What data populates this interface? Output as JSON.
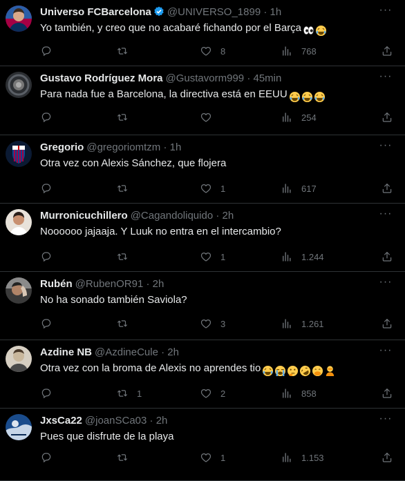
{
  "tweets": [
    {
      "name": "Universo FCBarcelona",
      "verified": true,
      "handle": "@UNIVERSO_1899",
      "time": "1h",
      "text": "Yo también, y creo que no acabaré fichando por el Barça",
      "emojis": [
        "eyes",
        "joy"
      ],
      "replies": "",
      "retweets": "",
      "likes": "8",
      "views": "768",
      "avatar_colors": [
        "#2b5ea7",
        "#a50044"
      ]
    },
    {
      "name": "Gustavo Rodríguez Mora",
      "verified": false,
      "handle": "@Gustavorm999",
      "time": "45min",
      "text": "Para nada fue a Barcelona, la directiva está en EEUU",
      "emojis": [
        "joy",
        "joy",
        "joy"
      ],
      "replies": "",
      "retweets": "",
      "likes": "",
      "views": "254",
      "avatar_colors": [
        "#5a5f66",
        "#2c2f33"
      ]
    },
    {
      "name": "Gregorio",
      "verified": false,
      "handle": "@gregoriomtzm",
      "time": "1h",
      "text": "Otra vez con Alexis Sánchez, que flojera",
      "emojis": [],
      "replies": "",
      "retweets": "",
      "likes": "1",
      "views": "617",
      "avatar_colors": [
        "#004d98",
        "#a50044"
      ]
    },
    {
      "name": "Murronicuchillero",
      "verified": false,
      "handle": "@Cagandoliquido",
      "time": "2h",
      "text": "Noooooo jajaaja. Y Luuk no entra en el intercambio?",
      "emojis": [],
      "replies": "",
      "retweets": "",
      "likes": "1",
      "views": "1.244",
      "avatar_colors": [
        "#e8e2da",
        "#2a1f1a"
      ]
    },
    {
      "name": "Rubén",
      "verified": false,
      "handle": "@RubenOR91",
      "time": "2h",
      "text": "No ha sonado también Saviola?",
      "emojis": [],
      "replies": "",
      "retweets": "",
      "likes": "3",
      "views": "1.261",
      "avatar_colors": [
        "#8a8a8a",
        "#3a3a3a"
      ]
    },
    {
      "name": "Azdine NB",
      "verified": false,
      "handle": "@AzdineCule",
      "time": "2h",
      "text": "Otra vez con la broma de Alexis no aprendes tio",
      "emojis": [
        "joy",
        "sob",
        "thinking",
        "rofl",
        "hand-over-mouth",
        "person-facepalm"
      ],
      "replies": "",
      "retweets": "1",
      "likes": "2",
      "views": "858",
      "avatar_colors": [
        "#c9b79c",
        "#4a3a2a"
      ]
    },
    {
      "name": "JxsCa22",
      "verified": false,
      "handle": "@joanSCa03",
      "time": "2h",
      "text": "Pues que disfrute de la playa",
      "emojis": [],
      "replies": "",
      "retweets": "",
      "likes": "1",
      "views": "1.153",
      "avatar_colors": [
        "#1a4c8c",
        "#c7d6e8"
      ]
    }
  ],
  "ui": {
    "dot": "·",
    "more": "···"
  },
  "colors": {
    "muted": "#71767b",
    "text": "#e7e9ea",
    "divider": "#2f3336",
    "verified": "#1d9bf0"
  }
}
